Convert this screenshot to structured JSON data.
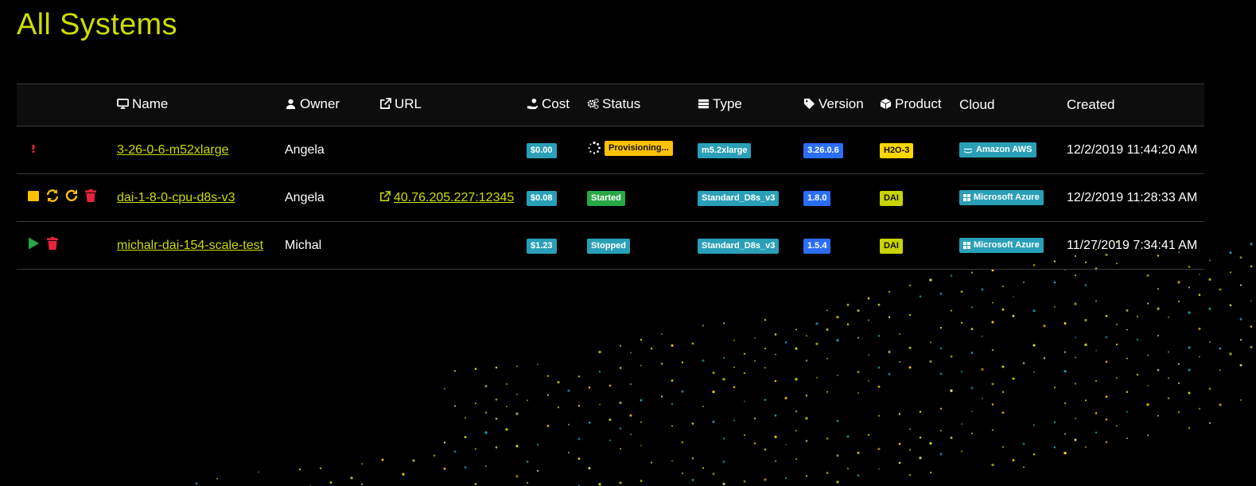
{
  "page": {
    "title": "All Systems"
  },
  "colors": {
    "accent": "#cddc00",
    "teal": "#2aa0b8",
    "blue": "#2a6ef6",
    "green": "#28a745",
    "yellow": "#ffd600",
    "danger": "#e5243b",
    "warn": "#ffc107"
  },
  "table": {
    "headers": {
      "name": "Name",
      "owner": "Owner",
      "url": "URL",
      "cost": "Cost",
      "status": "Status",
      "type": "Type",
      "version": "Version",
      "product": "Product",
      "cloud": "Cloud",
      "created": "Created"
    },
    "header_icons": {
      "name": "monitor-icon",
      "owner": "user-icon",
      "url": "external-link-icon",
      "cost": "hand-coin-icon",
      "status": "gears-icon",
      "type": "server-icon",
      "version": "tag-icon",
      "product": "cube-icon"
    },
    "rows": [
      {
        "actions": [
          "exclamation-icon"
        ],
        "name": "3-26-0-6-m52xlarge",
        "owner": "Angela",
        "url": "",
        "cost": "$0.00",
        "status": "Provisioning...",
        "status_icon": "spinner-icon",
        "type": "m5.2xlarge",
        "version": "3.26.0.6",
        "product": "H2O-3",
        "cloud": "Amazon AWS",
        "cloud_icon": "aws-icon",
        "created": "12/2/2019 11:44:20 AM"
      },
      {
        "actions": [
          "stop-icon",
          "sync-icon",
          "restart-icon",
          "trash-icon"
        ],
        "name": "dai-1-8-0-cpu-d8s-v3",
        "owner": "Angela",
        "url": "40.76.205.227:12345",
        "cost": "$0.08",
        "status": "Started",
        "type": "Standard_D8s_v3",
        "version": "1.8.0",
        "product": "DAI",
        "cloud": "Microsoft Azure",
        "cloud_icon": "windows-icon",
        "created": "12/2/2019 11:28:33 AM"
      },
      {
        "actions": [
          "play-icon",
          "trash-icon"
        ],
        "name": "michalr-dai-154-scale-test",
        "owner": "Michal",
        "url": "",
        "cost": "$1.23",
        "status": "Stopped",
        "type": "Standard_D8s_v3",
        "version": "1.5.4",
        "product": "DAI",
        "cloud": "Microsoft Azure",
        "cloud_icon": "windows-icon",
        "created": "11/27/2019 7:34:41 AM"
      }
    ]
  }
}
